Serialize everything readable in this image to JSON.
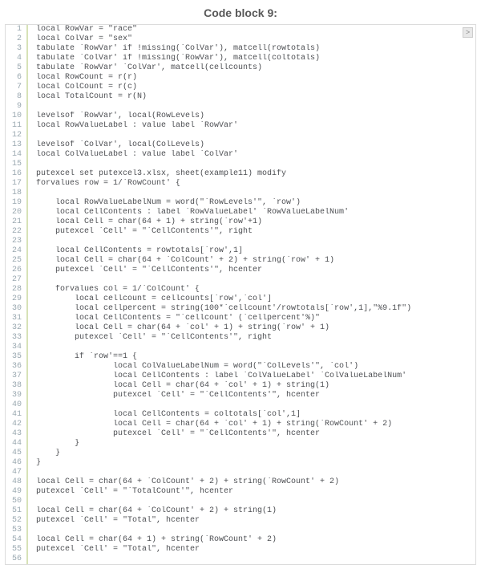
{
  "title": "Code block 9:",
  "expand_label": ">",
  "lines": [
    {
      "n": 1,
      "t": "local RowVar = \"race\""
    },
    {
      "n": 2,
      "t": "local ColVar = \"sex\""
    },
    {
      "n": 3,
      "t": "tabulate `RowVar' if !missing(`ColVar'), matcell(rowtotals)"
    },
    {
      "n": 4,
      "t": "tabulate `ColVar' if !missing(`RowVar'), matcell(coltotals)"
    },
    {
      "n": 5,
      "t": "tabulate `RowVar' `ColVar', matcell(cellcounts)"
    },
    {
      "n": 6,
      "t": "local RowCount = r(r)"
    },
    {
      "n": 7,
      "t": "local ColCount = r(c)"
    },
    {
      "n": 8,
      "t": "local TotalCount = r(N)"
    },
    {
      "n": 9,
      "t": ""
    },
    {
      "n": 10,
      "t": "levelsof `RowVar', local(RowLevels)"
    },
    {
      "n": 11,
      "t": "local RowValueLabel : value label `RowVar'"
    },
    {
      "n": 12,
      "t": ""
    },
    {
      "n": 13,
      "t": "levelsof `ColVar', local(ColLevels)"
    },
    {
      "n": 14,
      "t": "local ColValueLabel : value label `ColVar'"
    },
    {
      "n": 15,
      "t": ""
    },
    {
      "n": 16,
      "t": "putexcel set putexcel3.xlsx, sheet(example11) modify"
    },
    {
      "n": 17,
      "t": "forvalues row = 1/`RowCount' {"
    },
    {
      "n": 18,
      "t": ""
    },
    {
      "n": 19,
      "t": "    local RowValueLabelNum = word(\"`RowLevels'\", `row')"
    },
    {
      "n": 20,
      "t": "    local CellContents : label `RowValueLabel' `RowValueLabelNum'"
    },
    {
      "n": 21,
      "t": "    local Cell = char(64 + 1) + string(`row'+1)"
    },
    {
      "n": 22,
      "t": "    putexcel `Cell' = \"`CellContents'\", right"
    },
    {
      "n": 23,
      "t": ""
    },
    {
      "n": 24,
      "t": "    local CellContents = rowtotals[`row',1]"
    },
    {
      "n": 25,
      "t": "    local Cell = char(64 + `ColCount' + 2) + string(`row' + 1)"
    },
    {
      "n": 26,
      "t": "    putexcel `Cell' = \"`CellContents'\", hcenter"
    },
    {
      "n": 27,
      "t": ""
    },
    {
      "n": 28,
      "t": "    forvalues col = 1/`ColCount' {"
    },
    {
      "n": 29,
      "t": "        local cellcount = cellcounts[`row',`col']"
    },
    {
      "n": 30,
      "t": "        local cellpercent = string(100*`cellcount'/rowtotals[`row',1],\"%9.1f\")"
    },
    {
      "n": 31,
      "t": "        local CellContents = \"`cellcount' (`cellpercent'%)\""
    },
    {
      "n": 32,
      "t": "        local Cell = char(64 + `col' + 1) + string(`row' + 1)"
    },
    {
      "n": 33,
      "t": "        putexcel `Cell' = \"`CellContents'\", right"
    },
    {
      "n": 34,
      "t": ""
    },
    {
      "n": 35,
      "t": "        if `row'==1 {"
    },
    {
      "n": 36,
      "t": "                local ColValueLabelNum = word(\"`ColLevels'\", `col')"
    },
    {
      "n": 37,
      "t": "                local CellContents : label `ColValueLabel' `ColValueLabelNum'"
    },
    {
      "n": 38,
      "t": "                local Cell = char(64 + `col' + 1) + string(1)"
    },
    {
      "n": 39,
      "t": "                putexcel `Cell' = \"`CellContents'\", hcenter"
    },
    {
      "n": 40,
      "t": ""
    },
    {
      "n": 41,
      "t": "                local CellContents = coltotals[`col',1]"
    },
    {
      "n": 42,
      "t": "                local Cell = char(64 + `col' + 1) + string(`RowCount' + 2)"
    },
    {
      "n": 43,
      "t": "                putexcel `Cell' = \"`CellContents'\", hcenter"
    },
    {
      "n": 44,
      "t": "        }"
    },
    {
      "n": 45,
      "t": "    }"
    },
    {
      "n": 46,
      "t": "}"
    },
    {
      "n": 47,
      "t": ""
    },
    {
      "n": 48,
      "t": "local Cell = char(64 + `ColCount' + 2) + string(`RowCount' + 2)"
    },
    {
      "n": 49,
      "t": "putexcel `Cell' = \"`TotalCount'\", hcenter"
    },
    {
      "n": 50,
      "t": ""
    },
    {
      "n": 51,
      "t": "local Cell = char(64 + `ColCount' + 2) + string(1)"
    },
    {
      "n": 52,
      "t": "putexcel `Cell' = \"Total\", hcenter"
    },
    {
      "n": 53,
      "t": ""
    },
    {
      "n": 54,
      "t": "local Cell = char(64 + 1) + string(`RowCount' + 2)"
    },
    {
      "n": 55,
      "t": "putexcel `Cell' = \"Total\", hcenter"
    },
    {
      "n": 56,
      "t": ""
    }
  ]
}
